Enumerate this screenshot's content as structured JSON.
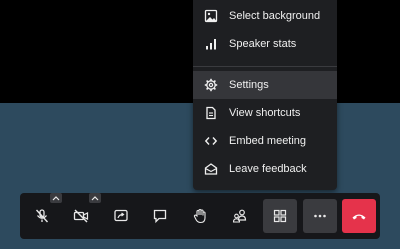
{
  "menu": {
    "items": [
      {
        "label": "Select background",
        "icon": "image-icon"
      },
      {
        "label": "Speaker stats",
        "icon": "bar-chart-icon"
      },
      {
        "label": "Settings",
        "icon": "gear-icon"
      },
      {
        "label": "View shortcuts",
        "icon": "document-icon"
      },
      {
        "label": "Embed meeting",
        "icon": "code-icon"
      },
      {
        "label": "Leave feedback",
        "icon": "feedback-envelope-icon"
      }
    ],
    "highlighted_item": "Settings"
  },
  "toolbar": {
    "buttons": [
      {
        "name": "microphone-muted",
        "icon": "mic-off-icon"
      },
      {
        "name": "camera-off",
        "icon": "camera-off-icon"
      },
      {
        "name": "share-screen",
        "icon": "screen-share-icon"
      },
      {
        "name": "chat",
        "icon": "chat-icon"
      },
      {
        "name": "raise-hand",
        "icon": "hand-icon"
      },
      {
        "name": "participants",
        "icon": "participants-icon"
      },
      {
        "name": "tile-view",
        "icon": "grid-icon",
        "active": true
      },
      {
        "name": "more-options",
        "icon": "more-dots-icon",
        "active": true
      },
      {
        "name": "hang-up",
        "icon": "phone-hangup-icon"
      }
    ]
  },
  "colors": {
    "background": "#2d4a5e",
    "video_area": "#000000",
    "menu_bg": "#1e1f22",
    "toolbar_bg": "#16171a",
    "hangup": "#e5334b"
  }
}
